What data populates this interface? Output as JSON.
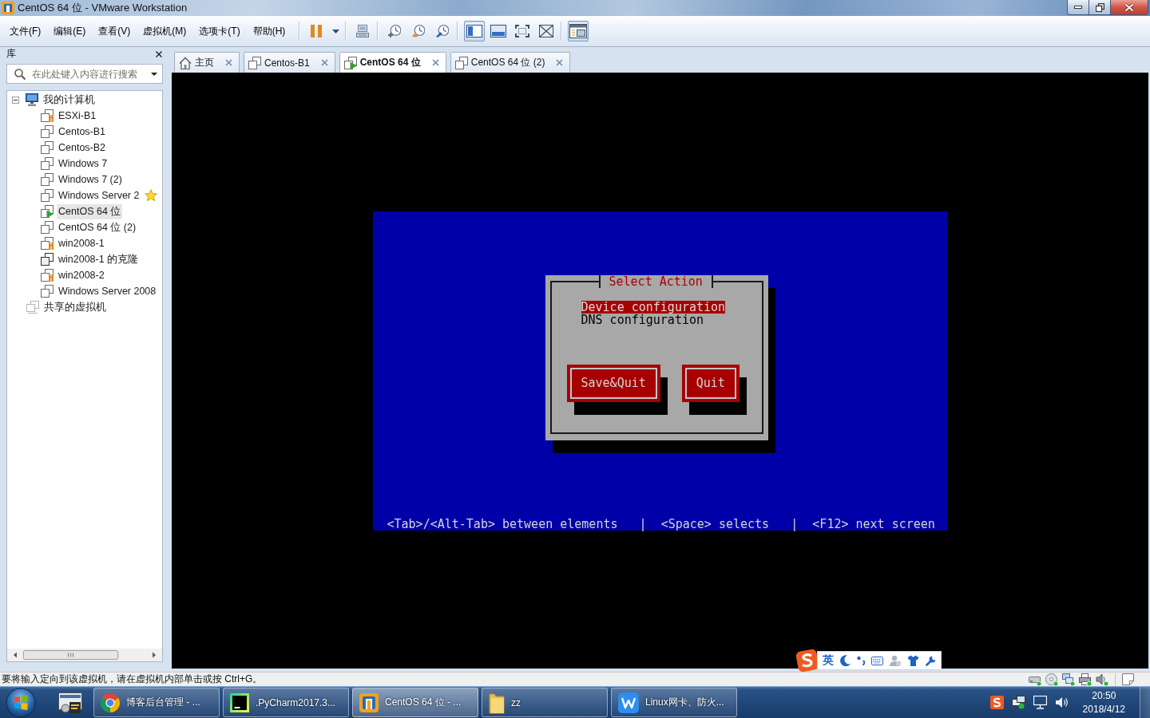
{
  "window": {
    "title": "CentOS 64 位 - VMware Workstation"
  },
  "menu": [
    "文件(F)",
    "编辑(E)",
    "查看(V)",
    "虚拟机(M)",
    "选项卡(T)",
    "帮助(H)"
  ],
  "toolbar_groups": [
    [
      {
        "kind": "pause",
        "on": false
      },
      {
        "kind": "caret",
        "on": false
      }
    ],
    [
      {
        "kind": "keys",
        "on": false
      }
    ],
    [
      {
        "kind": "snapshot",
        "on": false
      },
      {
        "kind": "revert",
        "on": false
      },
      {
        "kind": "manager",
        "on": false
      }
    ],
    [
      {
        "kind": "sidebar",
        "on": true
      },
      {
        "kind": "thumbnails",
        "on": false
      },
      {
        "kind": "fullscreen",
        "on": false
      },
      {
        "kind": "unity",
        "on": false
      }
    ],
    [
      {
        "kind": "console",
        "on": true
      }
    ]
  ],
  "library": {
    "title": "库",
    "search": {
      "placeholder": "在此处键入内容进行搜索"
    },
    "tree": [
      {
        "label": "我的计算机",
        "kind": "computer",
        "expanded": true,
        "selected": false,
        "children": [
          {
            "label": "ESXi-B1",
            "kind": "bars",
            "selected": false,
            "running": false,
            "starred": false
          },
          {
            "label": "Centos-B1",
            "kind": "vm",
            "selected": false,
            "running": false,
            "starred": false
          },
          {
            "label": "Centos-B2",
            "kind": "vm",
            "selected": false,
            "running": false,
            "starred": false
          },
          {
            "label": "Windows 7",
            "kind": "vm",
            "selected": false,
            "running": false,
            "starred": false
          },
          {
            "label": "Windows 7 (2)",
            "kind": "vm",
            "selected": false,
            "running": false,
            "starred": false
          },
          {
            "label": "Windows Server 2",
            "kind": "vm",
            "selected": false,
            "running": false,
            "starred": true
          },
          {
            "label": "CentOS 64 位",
            "kind": "vm",
            "selected": true,
            "running": true,
            "starred": false
          },
          {
            "label": "CentOS 64 位 (2)",
            "kind": "vm",
            "selected": false,
            "running": false,
            "starred": false
          },
          {
            "label": "win2008-1",
            "kind": "bars",
            "selected": false,
            "running": false,
            "starred": false
          },
          {
            "label": "win2008-1 的克隆",
            "kind": "clone",
            "selected": false,
            "running": false,
            "starred": false
          },
          {
            "label": "win2008-2",
            "kind": "bars",
            "selected": false,
            "running": false,
            "starred": false
          },
          {
            "label": "Windows Server 2008",
            "kind": "vm",
            "selected": false,
            "running": false,
            "starred": false
          }
        ]
      },
      {
        "label": "共享的虚拟机",
        "kind": "shared",
        "selected": false
      }
    ]
  },
  "tabs": [
    {
      "label": "主页",
      "kind": "home",
      "selected": false,
      "running": false
    },
    {
      "label": "Centos-B1",
      "kind": "vm",
      "selected": false,
      "running": false
    },
    {
      "label": "CentOS 64 位",
      "kind": "vm",
      "selected": true,
      "running": true
    },
    {
      "label": "CentOS 64 位 (2)",
      "kind": "vm",
      "selected": false,
      "running": false
    }
  ],
  "console": {
    "dialog": {
      "title": "Select Action",
      "items": [
        {
          "label": "Device configuration",
          "selected": true
        },
        {
          "label": "DNS configuration",
          "selected": false
        }
      ],
      "buttons": [
        "Save&Quit",
        "Quit"
      ]
    },
    "hint": "<Tab>/<Alt-Tab> between elements   |  <Space> selects   |  <F12> next screen"
  },
  "ime_bar": {
    "mode": "英"
  },
  "status_bar": {
    "message": "要将输入定向到该虚拟机，请在虚拟机内部单击或按 Ctrl+G。"
  },
  "taskbar": {
    "tasks": [
      {
        "label": "博客后台管理 - ...",
        "kind": "chrome",
        "selected": false
      },
      {
        "label": ".PyCharm2017.3...",
        "kind": "pycharm",
        "selected": false
      },
      {
        "label": "CentOS 64 位 - ...",
        "kind": "vmware",
        "selected": true
      },
      {
        "label": "zz",
        "kind": "folder",
        "selected": false
      },
      {
        "label": "Linux网卡、防火...",
        "kind": "writer",
        "selected": false
      }
    ],
    "clock": {
      "time": "20:50",
      "date": "2018/4/12"
    }
  }
}
